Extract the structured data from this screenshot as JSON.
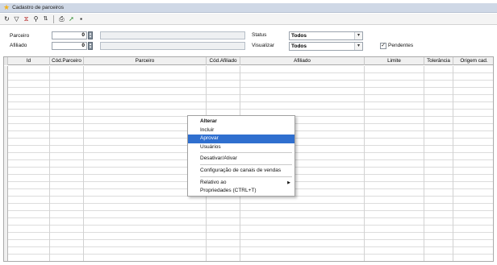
{
  "window": {
    "title": "Cadastro de parceiros"
  },
  "toolbar": {
    "icons": [
      "refresh-icon",
      "filter-icon",
      "clear-filter-icon",
      "search-icon",
      "sort-icon",
      "print-icon",
      "export-icon",
      "save-icon"
    ]
  },
  "filters": {
    "parceiro_label": "Parceiro",
    "parceiro_value": "0",
    "afiliado_label": "Afiliado",
    "afiliado_value": "0",
    "status_label": "Status",
    "status_value": "Todos",
    "visualizar_label": "Visualizar",
    "visualizar_value": "Todos",
    "pendentes_label": "Pendentes",
    "pendentes_checked": true
  },
  "grid": {
    "columns": [
      "Id",
      "Cód.Parceiro",
      "Parceiro",
      "Cód.Afiliado",
      "Afiliado",
      "Limite",
      "Tolerância",
      "Origem cad."
    ]
  },
  "context_menu": {
    "items": [
      {
        "label": "Alterar",
        "bold": true
      },
      {
        "label": "Incluir"
      },
      {
        "label": "Aprovar",
        "highlighted": true
      },
      {
        "label": "Usuários"
      },
      {
        "separator": true
      },
      {
        "label": "Desativar/Ativar"
      },
      {
        "separator": true
      },
      {
        "label": "Configuração de canais de vendas"
      },
      {
        "separator": true
      },
      {
        "label": "Relativo ao",
        "submenu": true
      },
      {
        "label": "Propriedades (CTRL+T)"
      }
    ]
  },
  "colors": {
    "title_bar": "#cfd8e6",
    "menu_highlight": "#2f6fcf",
    "star": "#f2b21b"
  }
}
